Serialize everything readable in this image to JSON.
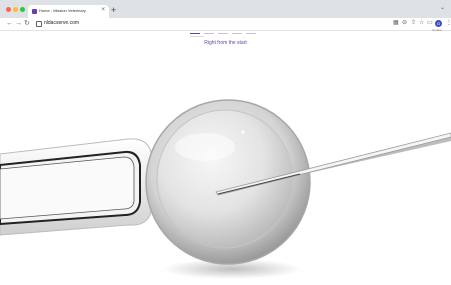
{
  "browser": {
    "tab_title": "Home - Mission Veterinary",
    "tab_close": "×",
    "new_tab": "+",
    "url": "nldacserve.com",
    "profile_initial": "G",
    "update_label": "Update",
    "icons": {
      "back": "arrow-left-icon",
      "forward": "arrow-right-icon",
      "reload": "reload-icon",
      "lock": "lock-icon"
    },
    "colors": {
      "close": "#ff5f57",
      "minimize": "#febc2e",
      "maximize": "#28c840",
      "accent": "#6b3fa0"
    }
  },
  "page": {
    "tagline": "Right from the start"
  }
}
